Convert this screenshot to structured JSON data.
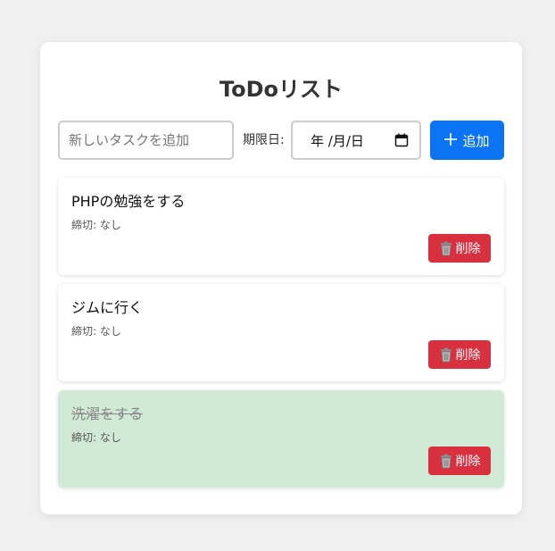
{
  "app": {
    "title": "ToDoリスト"
  },
  "form": {
    "task_placeholder": "新しいタスクを追加",
    "due_label": "期限日:",
    "date_display": "年 /月/日",
    "add_label": "追加"
  },
  "tasks": [
    {
      "title": "PHPの勉強をする",
      "due": "締切: なし",
      "completed": false,
      "delete_label": "削除"
    },
    {
      "title": "ジムに行く",
      "due": "締切: なし",
      "completed": false,
      "delete_label": "削除"
    },
    {
      "title": "洗濯をする",
      "due": "締切: なし",
      "completed": true,
      "delete_label": "削除"
    }
  ],
  "icons": {
    "add": "plus-icon",
    "calendar": "calendar-icon",
    "delete": "trash-icon"
  },
  "colors": {
    "primary": "#0a74f5",
    "danger": "#d9303f",
    "completed_bg": "#d1ead5"
  }
}
